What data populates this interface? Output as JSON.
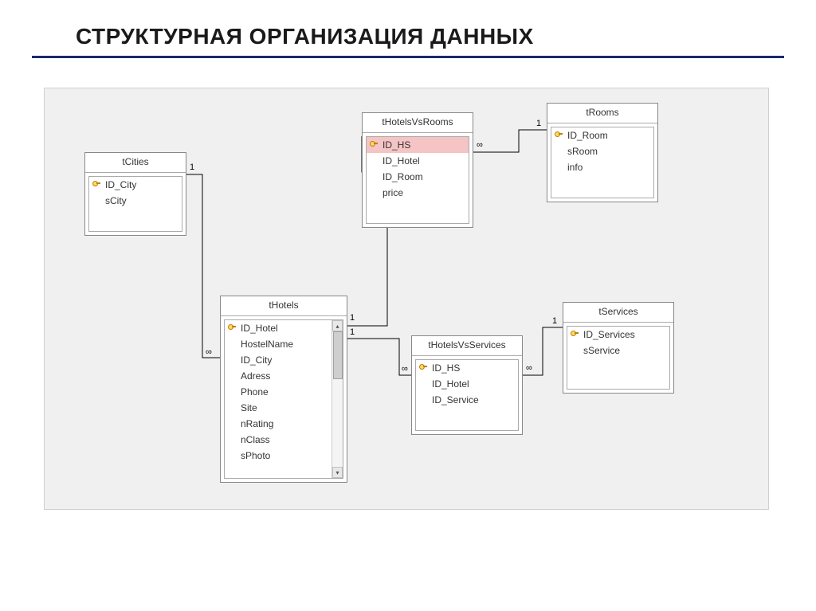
{
  "page": {
    "title": "СТРУКТУРНАЯ ОРГАНИЗАЦИЯ ДАННЫХ"
  },
  "tables": {
    "tCities": {
      "name": "tCities",
      "fields": [
        {
          "key": true,
          "name": "ID_City"
        },
        {
          "key": false,
          "name": "sCity"
        }
      ]
    },
    "tHotels": {
      "name": "tHotels",
      "fields": [
        {
          "key": true,
          "name": "ID_Hotel"
        },
        {
          "key": false,
          "name": "HostelName"
        },
        {
          "key": false,
          "name": "ID_City"
        },
        {
          "key": false,
          "name": "Adress"
        },
        {
          "key": false,
          "name": "Phone"
        },
        {
          "key": false,
          "name": "Site"
        },
        {
          "key": false,
          "name": "nRating"
        },
        {
          "key": false,
          "name": "nClass"
        },
        {
          "key": false,
          "name": "sPhoto"
        }
      ]
    },
    "tHotelsVsRooms": {
      "name": "tHotelsVsRooms",
      "selectedIndex": 0,
      "fields": [
        {
          "key": true,
          "name": "ID_HS"
        },
        {
          "key": false,
          "name": "ID_Hotel"
        },
        {
          "key": false,
          "name": "ID_Room"
        },
        {
          "key": false,
          "name": "price"
        }
      ]
    },
    "tRooms": {
      "name": "tRooms",
      "fields": [
        {
          "key": true,
          "name": "ID_Room"
        },
        {
          "key": false,
          "name": "sRoom"
        },
        {
          "key": false,
          "name": "info"
        }
      ]
    },
    "tHotelsVsServices": {
      "name": "tHotelsVsServices",
      "fields": [
        {
          "key": true,
          "name": "ID_HS"
        },
        {
          "key": false,
          "name": "ID_Hotel"
        },
        {
          "key": false,
          "name": "ID_Service"
        }
      ]
    },
    "tServices": {
      "name": "tServices",
      "fields": [
        {
          "key": true,
          "name": "ID_Services"
        },
        {
          "key": false,
          "name": "sService"
        }
      ]
    }
  },
  "labels": {
    "one": "1",
    "many": "∞"
  }
}
